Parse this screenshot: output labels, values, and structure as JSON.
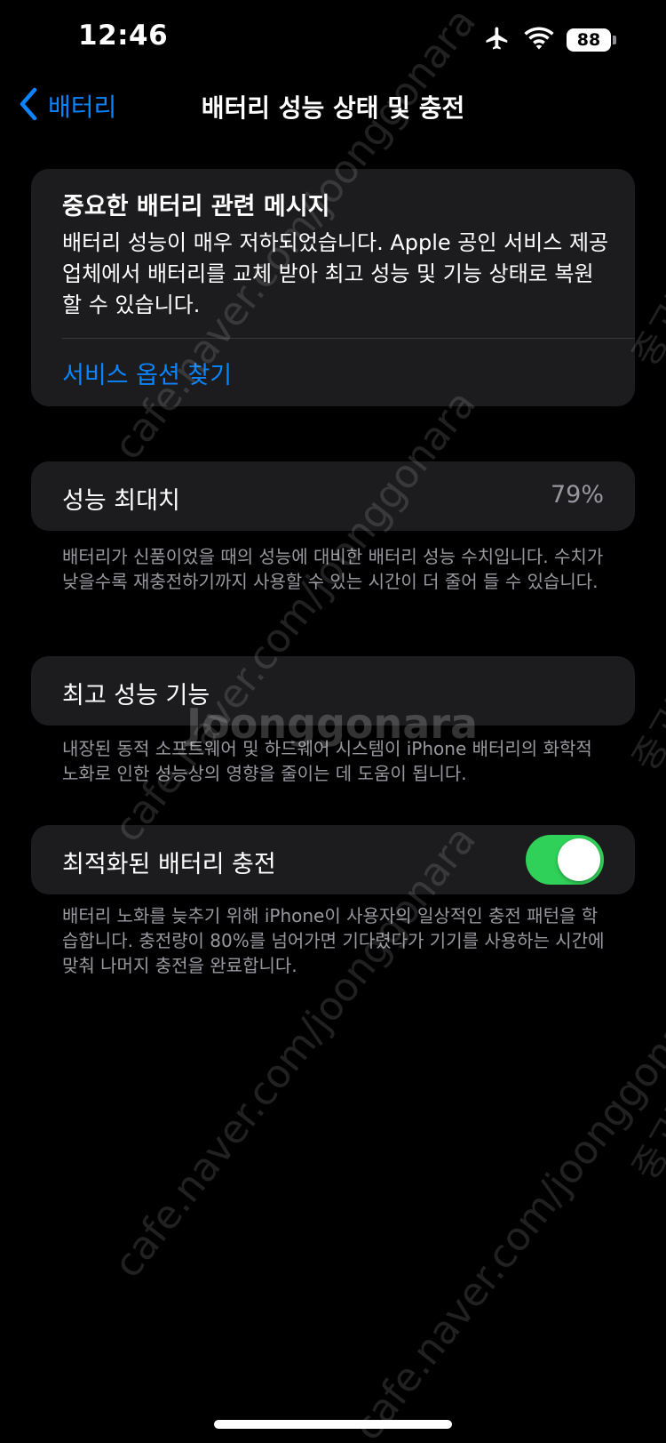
{
  "status_bar": {
    "time": "12:46",
    "battery_level": "88",
    "icons": [
      "airplane-icon",
      "wifi-icon",
      "battery-icon"
    ]
  },
  "nav": {
    "back_label": "배터리",
    "title": "배터리 성능 상태 및 충전"
  },
  "important_message": {
    "title": "중요한 배터리 관련 메시지",
    "body": "배터리 성능이 매우 저하되었습니다. Apple 공인 서비스 제공업체에서 배터리를 교체 받아 최고 성능 및 기능 상태로 복원할 수 있습니다.",
    "link": "서비스 옵션 찾기"
  },
  "maximum_capacity": {
    "label": "성능 최대치",
    "value": "79%",
    "footnote": "배터리가 신품이었을 때의 성능에 대비한 배터리 성능 수치입니다. 수치가 낮을수록 재충전하기까지 사용할 수 있는 시간이 더 줄어 들 수 있습니다."
  },
  "peak_performance": {
    "label": "최고 성능 기능",
    "footnote": "내장된 동적 소프트웨어 및 하드웨어 시스템이 iPhone 배터리의 화학적 노화로 인한 성능상의 영향을 줄이는 데 도움이 됩니다."
  },
  "optimized_charging": {
    "label": "최적화된 배터리 충전",
    "enabled": true,
    "footnote": "배터리 노화를 늦추기 위해 iPhone이 사용자의 일상적인 충전 패턴을 학습합니다. 충전량이 80%를 넘어가면 기다렸다가 기기를 사용하는 시간에 맞춰 나머지 충전을 완료합니다."
  },
  "watermark": {
    "line1": "cafe.naver.com/joonggonara",
    "line2": "Joonggonara",
    "line3": "중고나라"
  },
  "colors": {
    "background": "#000000",
    "card": "#1c1c1e",
    "accent": "#0a84ff",
    "toggle_on": "#30d158",
    "secondary_text": "#98989f"
  }
}
